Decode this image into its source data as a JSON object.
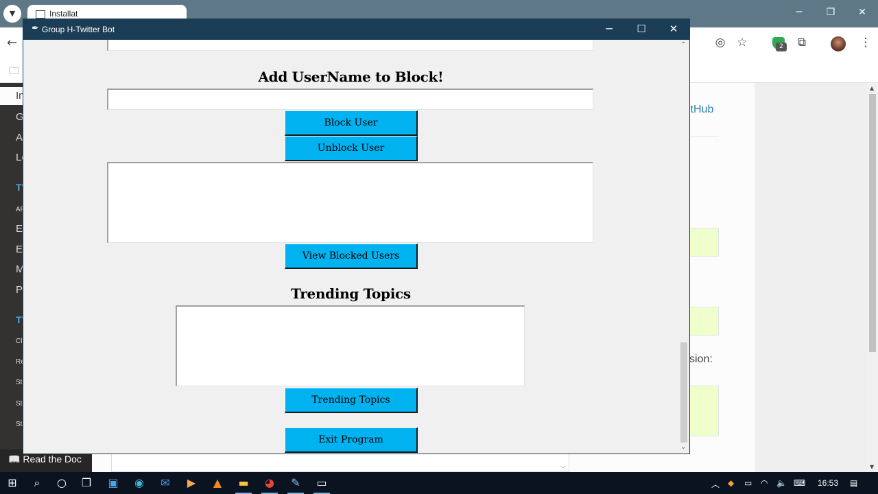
{
  "browser": {
    "tab_title": "Installat",
    "link_text": "itHub",
    "body_text": "sion:",
    "sidebar": {
      "selected_item": "In",
      "items": [
        "G",
        "A",
        "Lo",
        "TV",
        "AF",
        "E",
        "E",
        "M",
        "P",
        "TV",
        "Cl",
        "Re",
        "St",
        "St",
        "St"
      ],
      "footer": "Read the Doc"
    }
  },
  "window": {
    "title": "Group H-Twitter Bot",
    "minimize_icon": "minimize-icon",
    "maximize_icon": "maximize-icon",
    "close_icon": "close-icon"
  },
  "block_section": {
    "heading": "Add UserName to Block!",
    "username_value": "",
    "block_button": "Block User",
    "unblock_button": "Unblock User",
    "output_text": "",
    "view_blocked_button": "View Blocked Users"
  },
  "trending_section": {
    "heading": "Trending Topics",
    "output_text": "",
    "trending_button": "Trending Topics"
  },
  "exit_button": "Exit Program",
  "taskbar": {
    "time": "16:53",
    "extensions_badge": "2"
  },
  "colors": {
    "button_bg": "#00b2f0",
    "titlebar_bg": "#1b3d55",
    "window_bg": "#f0f0f0"
  }
}
